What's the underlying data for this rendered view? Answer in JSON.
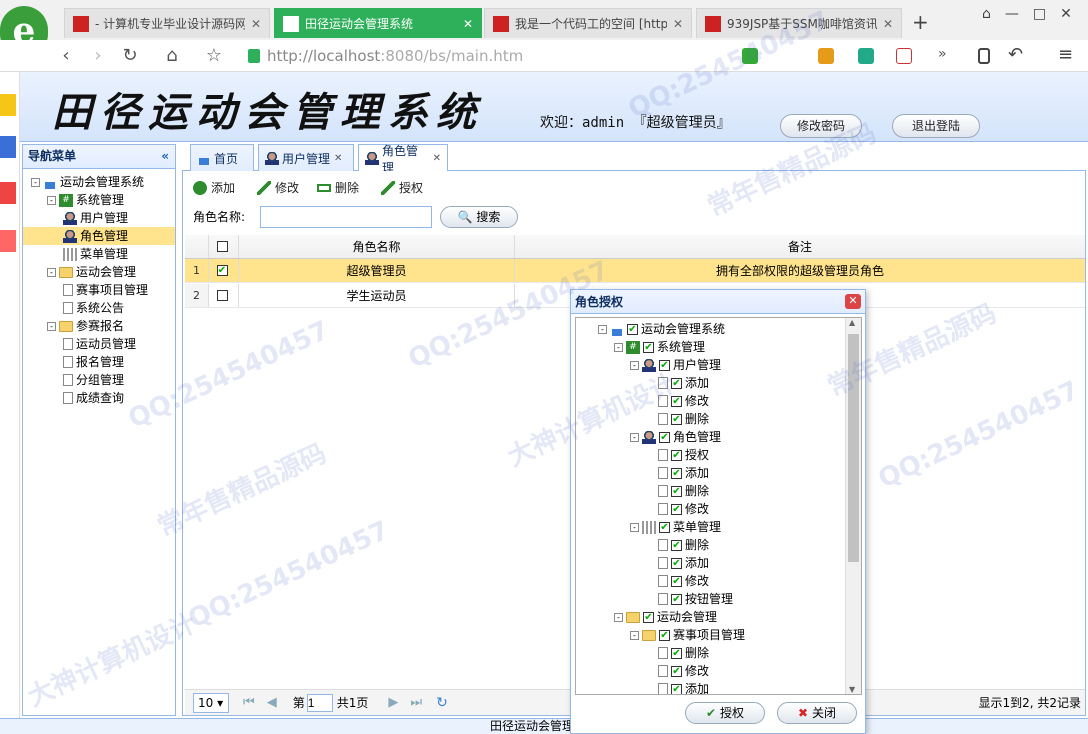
{
  "browser": {
    "tabs": [
      {
        "label": "- 计算机专业毕业设计源码网",
        "active": false
      },
      {
        "label": "田径运动会管理系统",
        "active": true
      },
      {
        "label": "我是一个代码工的空间 [http",
        "active": false
      },
      {
        "label": "939JSP基于SSM咖啡馆资讯",
        "active": false
      }
    ],
    "url_host": "http://localhost",
    "url_rest": ":8080/bs/main.htm",
    "new_tab": "+"
  },
  "app": {
    "title": "田径运动会管理系统",
    "welcome": "欢迎：admin 『超级管理员』",
    "change_pwd": "修改密码",
    "logout": "退出登陆",
    "footer": "田径运动会管理系统"
  },
  "nav": {
    "title": "导航菜单",
    "collapse": "«",
    "tree": [
      {
        "label": "运动会管理系统",
        "level": 0,
        "icon": "house",
        "toggle": "-"
      },
      {
        "label": "系统管理",
        "level": 1,
        "icon": "hash",
        "toggle": "-"
      },
      {
        "label": "用户管理",
        "level": 2,
        "icon": "user"
      },
      {
        "label": "角色管理",
        "level": 2,
        "icon": "user",
        "selected": true
      },
      {
        "label": "菜单管理",
        "level": 2,
        "icon": "grid"
      },
      {
        "label": "运动会管理",
        "level": 1,
        "icon": "folder",
        "toggle": "-"
      },
      {
        "label": "赛事项目管理",
        "level": 2,
        "icon": "file"
      },
      {
        "label": "系统公告",
        "level": 2,
        "icon": "file"
      },
      {
        "label": "参赛报名",
        "level": 1,
        "icon": "folder",
        "toggle": "-"
      },
      {
        "label": "运动员管理",
        "level": 2,
        "icon": "file"
      },
      {
        "label": "报名管理",
        "level": 2,
        "icon": "file"
      },
      {
        "label": "分组管理",
        "level": 2,
        "icon": "file"
      },
      {
        "label": "成绩查询",
        "level": 2,
        "icon": "file"
      }
    ]
  },
  "tabs": [
    {
      "label": "首页",
      "icon": "house",
      "closable": false
    },
    {
      "label": "用户管理",
      "icon": "user",
      "closable": true
    },
    {
      "label": "角色管理",
      "icon": "user",
      "closable": true,
      "active": true
    }
  ],
  "toolbar": {
    "add": "添加",
    "edit": "修改",
    "delete": "删除",
    "authorize": "授权",
    "search_label": "角色名称:",
    "search_value": "",
    "search_btn": "搜索"
  },
  "grid": {
    "columns": [
      "角色名称",
      "备注"
    ],
    "rows": [
      {
        "num": "1",
        "checked": true,
        "name": "超级管理员",
        "note": "拥有全部权限的超级管理员角色"
      },
      {
        "num": "2",
        "checked": false,
        "name": "学生运动员",
        "note": ""
      }
    ]
  },
  "pager": {
    "page_size": "10",
    "page_prefix": "第",
    "page_value": "1",
    "page_total": "共1页",
    "summary": "显示1到2, 共2记录"
  },
  "dialog": {
    "title": "角色授权",
    "close": "✕",
    "tree": [
      {
        "label": "运动会管理系统",
        "level": 0,
        "icon": "house",
        "toggle": "-"
      },
      {
        "label": "系统管理",
        "level": 1,
        "icon": "hash",
        "toggle": "-"
      },
      {
        "label": "用户管理",
        "level": 2,
        "icon": "user",
        "toggle": "-"
      },
      {
        "label": "添加",
        "level": 3,
        "icon": "file"
      },
      {
        "label": "修改",
        "level": 3,
        "icon": "file"
      },
      {
        "label": "删除",
        "level": 3,
        "icon": "file"
      },
      {
        "label": "角色管理",
        "level": 2,
        "icon": "user",
        "toggle": "-"
      },
      {
        "label": "授权",
        "level": 3,
        "icon": "file"
      },
      {
        "label": "添加",
        "level": 3,
        "icon": "file"
      },
      {
        "label": "删除",
        "level": 3,
        "icon": "file"
      },
      {
        "label": "修改",
        "level": 3,
        "icon": "file"
      },
      {
        "label": "菜单管理",
        "level": 2,
        "icon": "grid",
        "toggle": "-"
      },
      {
        "label": "删除",
        "level": 3,
        "icon": "file"
      },
      {
        "label": "添加",
        "level": 3,
        "icon": "file"
      },
      {
        "label": "修改",
        "level": 3,
        "icon": "file"
      },
      {
        "label": "按钮管理",
        "level": 3,
        "icon": "file"
      },
      {
        "label": "运动会管理",
        "level": 1,
        "icon": "folder",
        "toggle": "-"
      },
      {
        "label": "赛事项目管理",
        "level": 2,
        "icon": "folder",
        "toggle": "-"
      },
      {
        "label": "删除",
        "level": 3,
        "icon": "file"
      },
      {
        "label": "修改",
        "level": 3,
        "icon": "file"
      },
      {
        "label": "添加",
        "level": 3,
        "icon": "file"
      }
    ],
    "ok": "授权",
    "cancel": "关闭"
  },
  "watermarks": [
    "QQ:254540457",
    "常年售精品源码",
    "大神计算机设计"
  ],
  "colors": {
    "accent": "#95b8e7",
    "highlight": "#ffe48d",
    "tab_active": "#2eb05a"
  }
}
